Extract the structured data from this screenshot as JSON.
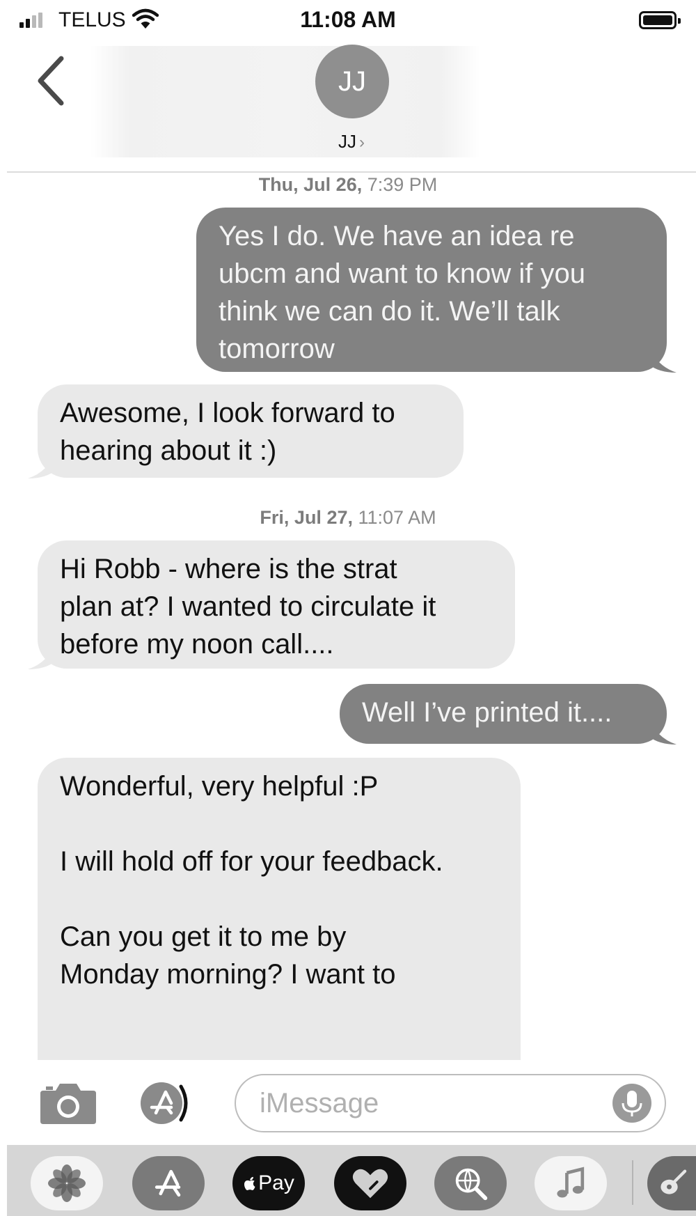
{
  "status_bar": {
    "carrier": "TELUS",
    "time": "11:08 AM",
    "signal_bars_filled": 2,
    "signal_bars_total": 4
  },
  "header": {
    "avatar_initials": "JJ",
    "contact_name": "JJ",
    "chevron": "›",
    "back_icon": "chevron-left-icon"
  },
  "transcript": {
    "timestamps": [
      {
        "day": "Thu, Jul 26,",
        "time": "7:39 PM"
      },
      {
        "day": "Fri, Jul 27,",
        "time": "11:07 AM"
      }
    ],
    "messages": [
      {
        "direction": "outgoing",
        "lines": [
          "Yes I do. We have an idea re",
          "ubcm and want to know if you",
          "think we can do it. We’ll talk",
          "tomorrow"
        ]
      },
      {
        "direction": "incoming",
        "lines": [
          "Awesome, I look forward to",
          "hearing about it :)"
        ]
      },
      {
        "direction": "incoming",
        "lines": [
          "Hi Robb - where is the strat",
          "plan at? I wanted to circulate it",
          "before my noon call...."
        ]
      },
      {
        "direction": "outgoing",
        "lines": [
          "Well I’ve printed it...."
        ]
      },
      {
        "direction": "incoming",
        "lines": [
          "Wonderful, very helpful :P",
          "",
          "I will hold off for your feedback.",
          "",
          "Can you get it to me by",
          "Monday morning? I want to"
        ]
      }
    ]
  },
  "compose": {
    "placeholder": "iMessage",
    "camera_icon": "camera-icon",
    "apps_icon": "app-store-icon",
    "mic_icon": "microphone-icon"
  },
  "app_drawer": {
    "apps": [
      {
        "name": "photos",
        "icon": "photos-icon"
      },
      {
        "name": "app-store",
        "icon": "app-store-icon"
      },
      {
        "name": "apple-pay",
        "icon": "apple-pay-icon",
        "label": "Pay"
      },
      {
        "name": "digital-touch",
        "icon": "heart-icon"
      },
      {
        "name": "web-search",
        "icon": "globe-search-icon"
      },
      {
        "name": "music",
        "icon": "music-note-icon"
      },
      {
        "name": "garageband",
        "icon": "guitar-icon"
      }
    ]
  },
  "colors": {
    "outgoing_bubble": "#828282",
    "incoming_bubble": "#e9e9e9",
    "timestamp_text": "#8a8a8a",
    "drawer_background": "#d6d6d6"
  }
}
